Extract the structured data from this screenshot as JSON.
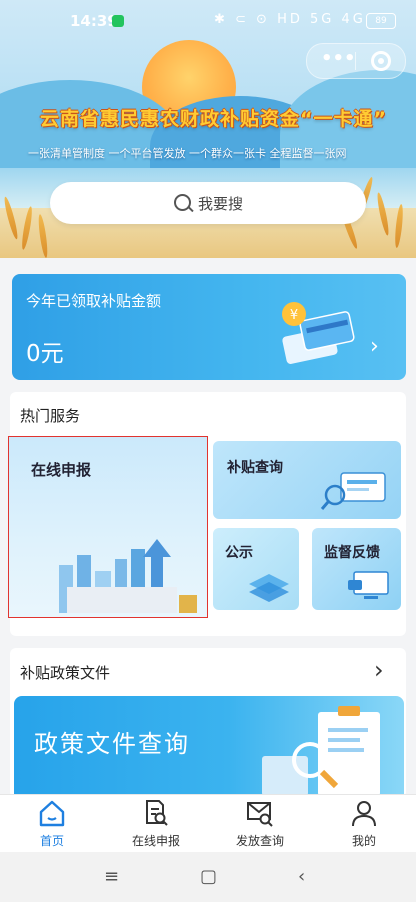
{
  "status_bar": {
    "time": "14:39",
    "icons": "✱ ⊂ ⊙ HD 5G 4G",
    "battery": "89"
  },
  "banner": {
    "title": "云南省惠民惠农财政补贴资金“一卡通”",
    "slogan": "一张清单管制度  一个平台管发放  一个群众一张卡  全程监督一张网",
    "capsule": {
      "more": "•••"
    }
  },
  "search": {
    "placeholder": "我要搜"
  },
  "subsidy_card": {
    "label": "今年已领取补贴金额",
    "amount": "0元",
    "arrow": "›"
  },
  "hot_services": {
    "title": "热门服务",
    "items": [
      {
        "label": "在线申报"
      },
      {
        "label": "补贴查询"
      },
      {
        "label": "公示"
      },
      {
        "label": "监督反馈"
      }
    ]
  },
  "policy": {
    "title": "补贴政策文件",
    "arrow": "›",
    "banner_label": "政策文件查询"
  },
  "bottom_nav": {
    "items": [
      {
        "label": "首页",
        "icon": "home-icon"
      },
      {
        "label": "在线申报",
        "icon": "document-search-icon"
      },
      {
        "label": "发放查询",
        "icon": "mail-search-icon"
      },
      {
        "label": "我的",
        "icon": "person-icon"
      }
    ]
  },
  "system_nav": {
    "menu": "≡",
    "home": "▢",
    "back": "‹"
  },
  "colors": {
    "accent": "#1e7fe0",
    "card_blue": "#3aaeed",
    "highlight_border": "#e1342f",
    "title_yellow": "#ffcc33"
  }
}
